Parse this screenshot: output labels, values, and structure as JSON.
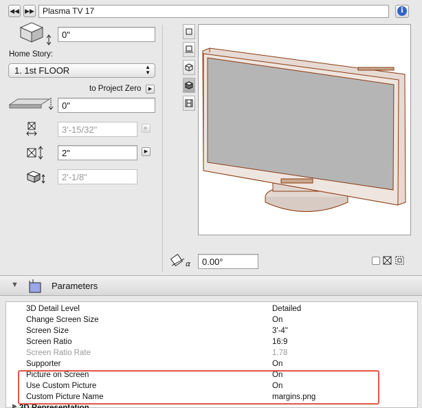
{
  "window": {
    "title": "Plasma TV 17"
  },
  "nav": {
    "prev_icon": "◀◀",
    "next_icon": "▶▶",
    "info_icon": "i"
  },
  "geometry": {
    "top_offset": "0\"",
    "home_story_label": "Home Story:",
    "home_story_value": "1. 1st FLOOR",
    "to_project_zero": "to Project Zero",
    "project_zero_offset": "0\"",
    "width": "3'-15/32\"",
    "height": "2\"",
    "depth": "2'-1/8\"",
    "rotation_angle": "0.00°"
  },
  "section": {
    "title": "Parameters"
  },
  "parameters": [
    {
      "name": "3D Detail Level",
      "value": "Detailed",
      "dim": false
    },
    {
      "name": "Change Screen Size",
      "value": "On",
      "dim": false
    },
    {
      "name": "Screen Size",
      "value": "3'-4\"",
      "dim": false
    },
    {
      "name": "Screen Ratio",
      "value": "16:9",
      "dim": false
    },
    {
      "name": "Screen Ratio Rate",
      "value": "1.78",
      "dim": true
    },
    {
      "name": "Supporter",
      "value": "On",
      "dim": false
    },
    {
      "name": "Picture on Screen",
      "value": "On",
      "dim": false
    },
    {
      "name": "Use Custom Picture",
      "value": "On",
      "dim": false
    },
    {
      "name": "Custom Picture Name",
      "value": "margins.png",
      "dim": false
    }
  ],
  "partial_row": {
    "label": "3D Representation"
  },
  "colors": {
    "highlight_box": "#e05545",
    "tv_outline": "#8a3a10",
    "screen": "#b5b5b5"
  }
}
